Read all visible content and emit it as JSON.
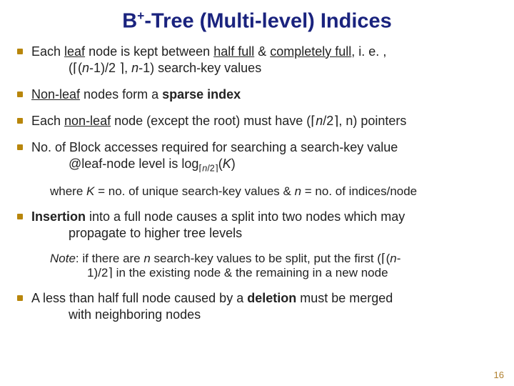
{
  "title_html": "B<sup>+</sup>-Tree (Multi-level) Indices",
  "bullets": [
    {
      "html": "Each <span class='u'>leaf</span> node is kept between <span class='u'>half full</span> &amp; <span class='u'>completely full</span>, i. e. , <span class='cont'>(<span class='ceil-l'>⌈</span>(<i>n</i>-1)/2 <span class='ceil-r'>⌉</span>, <i>n</i>-1) search-key values</span>"
    },
    {
      "html": "<span class='u'>Non-leaf</span> nodes form a <b>sparse index</b>"
    },
    {
      "html": "Each <span class='u'>non-leaf</span> node (except the root) must have (<span class='ceil-l'>⌈</span><i>n</i>/2<span class='ceil-r'>⌉</span>, n) pointers"
    },
    {
      "html": "No. of Block accesses required for searching a search-key value <span class='cont'>@leaf-node level is log<span class='subscript'><span class='ceil-l'>⌈</span><i>n</i>/2<span class='ceil-r'>⌉</span></span>(<i>K</i>)</span>",
      "sub_html": "where <i>K</i> = no. of unique search-key values &amp; <i>n</i> = no. of indices/node"
    },
    {
      "html": "<b>Insertion</b> into a full node causes a split into two nodes which may <span class='cont'>propagate to higher tree levels</span>",
      "sub_html": "<span class='note-italic'>Note</span>: if there are <i>n</i> search-key values to be split, put the first (<span class='ceil-l'>⌈</span>(<i>n</i>-<span class='cont'>1)/2<span class='ceil-r'>⌉</span> in the existing node &amp; the remaining in a new node</span>"
    },
    {
      "html": "A less than half full node caused by a <b>deletion</b> must be merged <span class='cont'>with neighboring nodes</span>"
    }
  ],
  "page_number": "16"
}
